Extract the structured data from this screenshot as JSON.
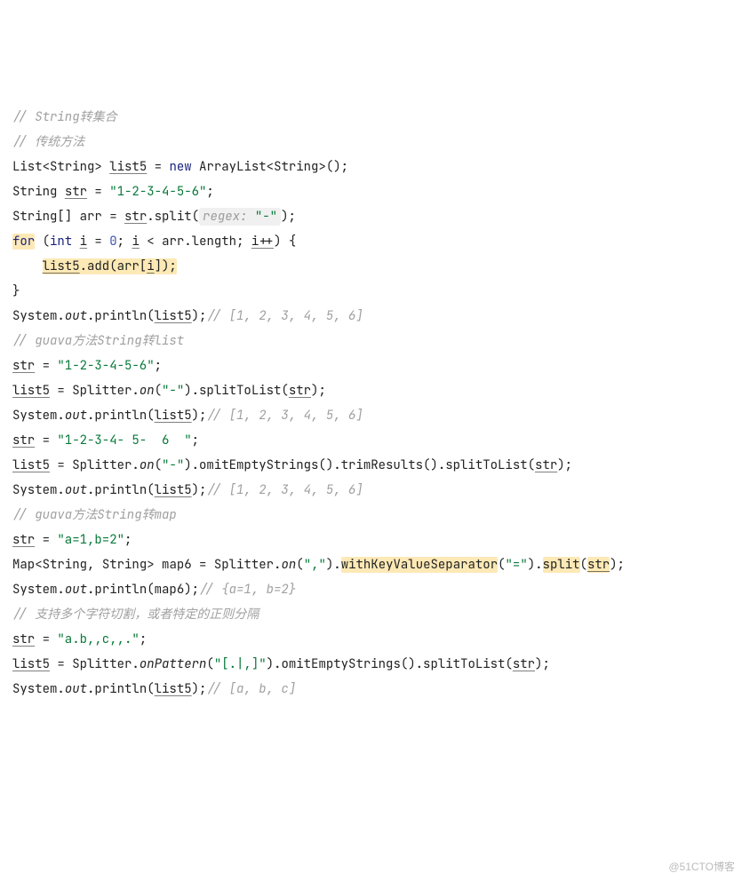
{
  "comment1": "// String转集合",
  "comment2": "// 传统方法",
  "l3": {
    "type1": "List",
    "type2": "String",
    "var": "list5",
    "kw": "new",
    "ctor": "ArrayList",
    "type3": "String"
  },
  "l4": {
    "type": "String",
    "var": "str",
    "val": "\"1-2-3-4-5-6\""
  },
  "l5": {
    "type": "String",
    "arr": "[]",
    "var": "arr",
    "src": "str",
    "m": ".split(",
    "hintLabel": "regex:",
    "hintVal": " \"-\"",
    "close": ");"
  },
  "l6": {
    "kwFor": "for",
    "kwInt": "int",
    "i": "i",
    "n0": "0",
    "arr": "arr",
    "len": ".length; ",
    "ipp": "i++"
  },
  "l7": {
    "indent": "    ",
    "obj": "list5",
    "call": ".add(arr[",
    "i": "i",
    "close": "]);"
  },
  "l8": {
    "brace": "}"
  },
  "l9": {
    "pre": "System.",
    "out": "out",
    "m": ".println(",
    "arg": "list5",
    "close": ");",
    "cm": "// [1, 2, 3, 4, 5, 6]"
  },
  "comment3": "// guava方法String转list",
  "l11": {
    "var": "str",
    "val": "\"1-2-3-4-5-6\""
  },
  "l12": {
    "a": "list5",
    "pre": " = Splitter.",
    "on": "on",
    "args": "(\"-\").splitToList(",
    "arg": "str",
    "close": ");",
    "onArg": "\"-\""
  },
  "l13": {
    "pre": "System.",
    "out": "out",
    "m": ".println(",
    "arg": "list5",
    "close": ");",
    "cm": "// [1, 2, 3, 4, 5, 6]"
  },
  "l14": {
    "var": "str",
    "val": "\"1-2-3-4- 5-  6  \""
  },
  "l15": {
    "a": "list5",
    "pre": " = Splitter.",
    "on": "on",
    "onArg": "\"-\"",
    "mid": ").omitEmptyStrings().trimResults().splitToList(",
    "arg": "str",
    "close": ");"
  },
  "l16": {
    "pre": "System.",
    "out": "out",
    "m": ".println(",
    "arg": "list5",
    "close": ");",
    "cm": "// [1, 2, 3, 4, 5, 6]"
  },
  "comment4": "// guava方法String转map",
  "l18": {
    "var": "str",
    "val": "\"a=1,b=2\""
  },
  "l19": {
    "type": "Map",
    "gen1": "String",
    "gen2": "String",
    "var": "map6",
    "pre": " = Splitter.",
    "on": "on",
    "onArg": "\",\"",
    "mid": ").",
    "hlMethod": "withKeyValueSeparator",
    "midArg": "(\"",
    "sepArg": "=",
    "mid2": "\").",
    "hlSplit": "split",
    "arg": "str",
    "close": ");"
  },
  "l20": {
    "pre": "System.",
    "out": "out",
    "m": ".println(map6);",
    "cm": "// {a=1, b=2}"
  },
  "comment5": "// 支持多个字符切割，或者特定的正则分隔",
  "l22": {
    "var": "str",
    "val": "\"a.b,,c,,.\""
  },
  "l23": {
    "a": "list5",
    "pre": " = Splitter.",
    "on": "onPattern",
    "onArg": "\"[.|,]\"",
    "mid": ").omitEmptyStrings().splitToList(",
    "arg": "str",
    "close": ");"
  },
  "l24": {
    "pre": "System.",
    "out": "out",
    "m": ".println(",
    "arg": "list5",
    "close": ");",
    "cm": "// [a, b, c]"
  },
  "watermark": "@51CTO博客"
}
